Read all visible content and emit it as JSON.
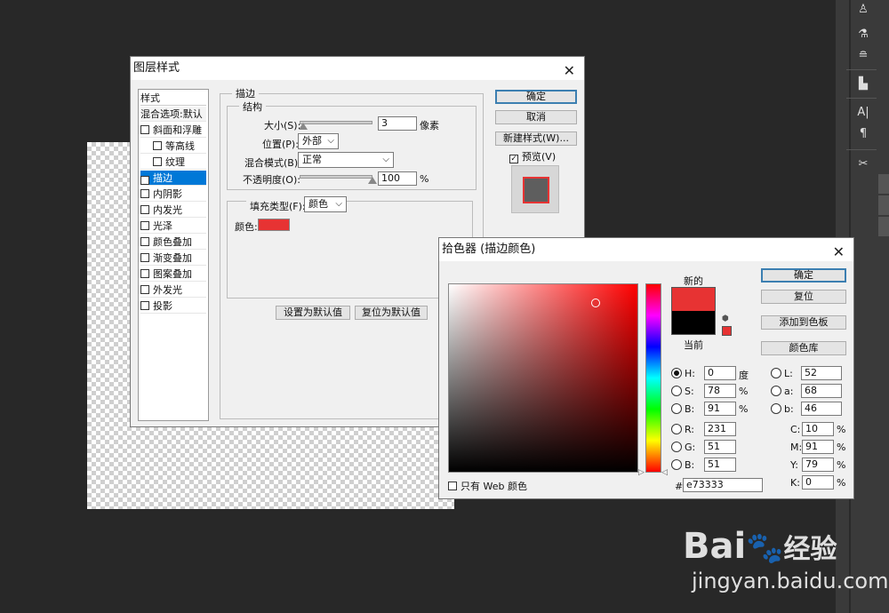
{
  "layer_style": {
    "title": "图层样式",
    "styles_header": "样式",
    "blend_default": "混合选项:默认",
    "style_items": [
      {
        "label": "斜面和浮雕",
        "checked": false,
        "selected": false
      },
      {
        "label": "等高线",
        "checked": false,
        "selected": false
      },
      {
        "label": "纹理",
        "checked": false,
        "selected": false
      },
      {
        "label": "描边",
        "checked": true,
        "selected": true
      },
      {
        "label": "内阴影",
        "checked": false,
        "selected": false
      },
      {
        "label": "内发光",
        "checked": false,
        "selected": false
      },
      {
        "label": "光泽",
        "checked": false,
        "selected": false
      },
      {
        "label": "颜色叠加",
        "checked": false,
        "selected": false
      },
      {
        "label": "渐变叠加",
        "checked": false,
        "selected": false
      },
      {
        "label": "图案叠加",
        "checked": false,
        "selected": false
      },
      {
        "label": "外发光",
        "checked": false,
        "selected": false
      },
      {
        "label": "投影",
        "checked": false,
        "selected": false
      }
    ],
    "stroke_section": "描边",
    "structure_section": "结构",
    "size_label": "大小(S):",
    "size_value": "3",
    "size_unit": "像素",
    "position_label": "位置(P):",
    "position_value": "外部",
    "blend_label": "混合模式(B):",
    "blend_value": "正常",
    "opacity_label": "不透明度(O):",
    "opacity_value": "100",
    "opacity_unit": "%",
    "fill_type_label": "填充类型(F):",
    "fill_type_value": "颜色",
    "color_label": "颜色:",
    "stroke_color": "#e73333",
    "set_default": "设置为默认值",
    "reset_default": "复位为默认值",
    "ok": "确定",
    "cancel": "取消",
    "new_style": "新建样式(W)...",
    "preview": "预览(V)"
  },
  "color_picker": {
    "title": "拾色器 (描边颜色)",
    "new_label": "新的",
    "current_label": "当前",
    "new_color": "#e73333",
    "current_color": "#000000",
    "ok": "确定",
    "reset": "复位",
    "add_swatch": "添加到色板",
    "color_library": "颜色库",
    "web_only": "只有 Web 颜色",
    "hsb": [
      {
        "label": "H:",
        "value": "0",
        "unit": "度",
        "selected": true
      },
      {
        "label": "S:",
        "value": "78",
        "unit": "%",
        "selected": false
      },
      {
        "label": "B:",
        "value": "91",
        "unit": "%",
        "selected": false
      }
    ],
    "rgb": [
      {
        "label": "R:",
        "value": "231"
      },
      {
        "label": "G:",
        "value": "51"
      },
      {
        "label": "B:",
        "value": "51"
      }
    ],
    "lab": [
      {
        "label": "L:",
        "value": "52"
      },
      {
        "label": "a:",
        "value": "68"
      },
      {
        "label": "b:",
        "value": "46"
      }
    ],
    "cmyk": [
      {
        "label": "C:",
        "value": "10"
      },
      {
        "label": "M:",
        "value": "91"
      },
      {
        "label": "Y:",
        "value": "79"
      },
      {
        "label": "K:",
        "value": "0"
      }
    ],
    "hex_label": "#",
    "hex_value": "e73333"
  },
  "watermark": {
    "brand": "Bai",
    "brand2": "经验",
    "url": "jingyan.baidu.com"
  }
}
